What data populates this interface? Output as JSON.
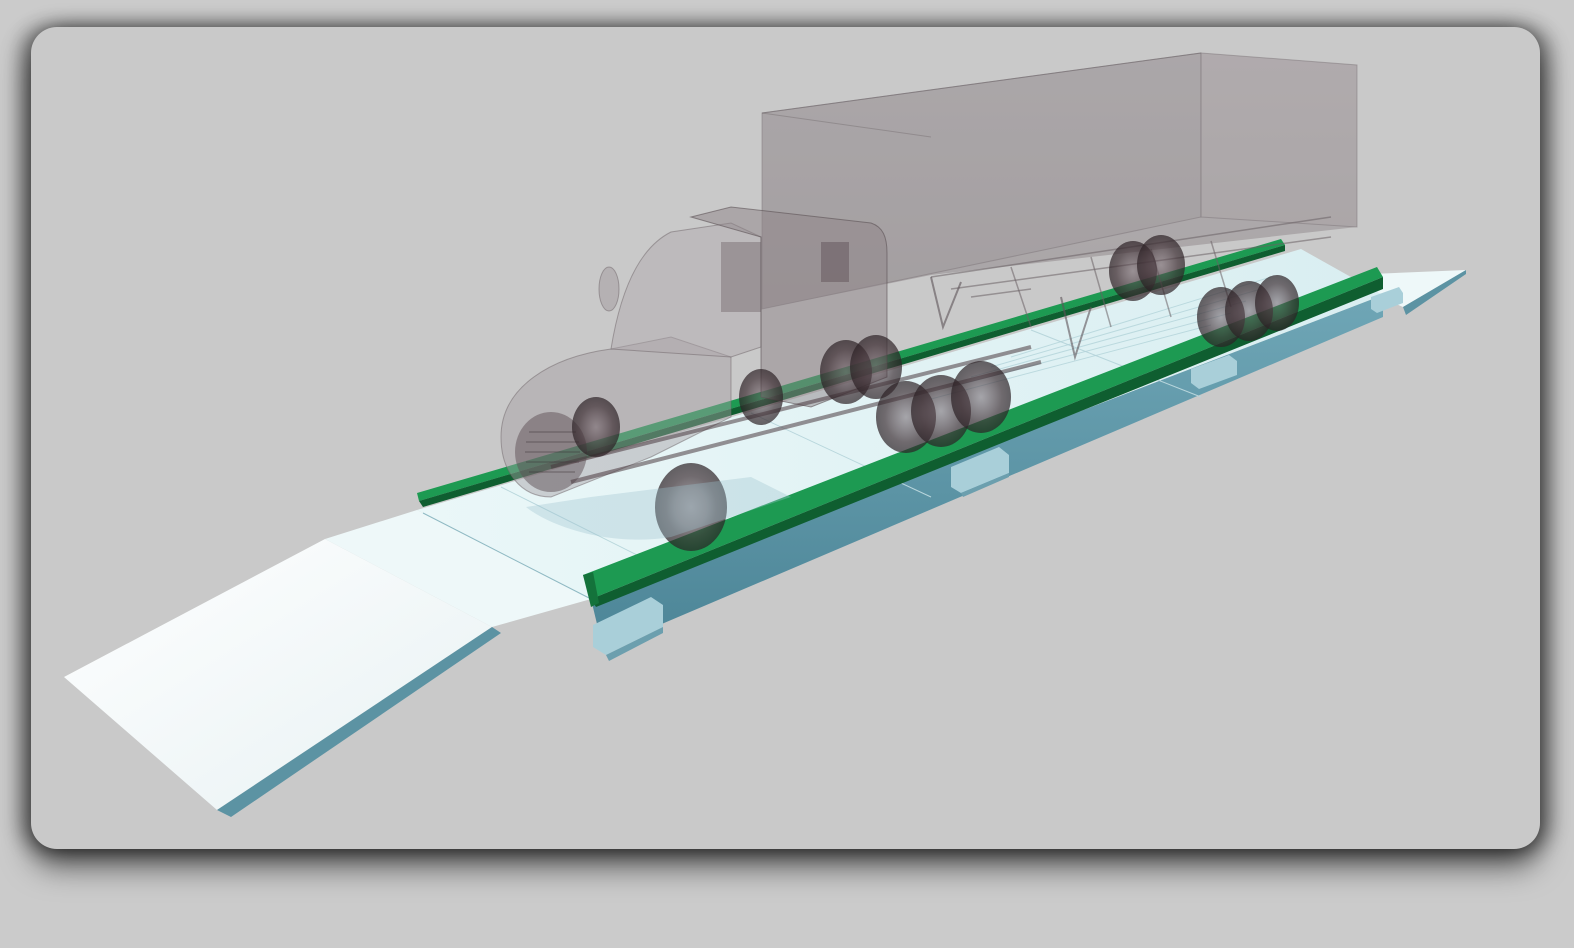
{
  "scene": {
    "subject": "truck-scale-weighbridge-render",
    "colors": {
      "background": "#c9c9c9",
      "platform_top": "#e8f4f6",
      "platform_side": "#5f97a8",
      "ramp_top": "#f4fafb",
      "rail_green": "#1a8a4a",
      "rail_green_dark": "#0f5e30",
      "truck_body": "#8a8286",
      "truck_dark": "#4a3a40"
    }
  }
}
